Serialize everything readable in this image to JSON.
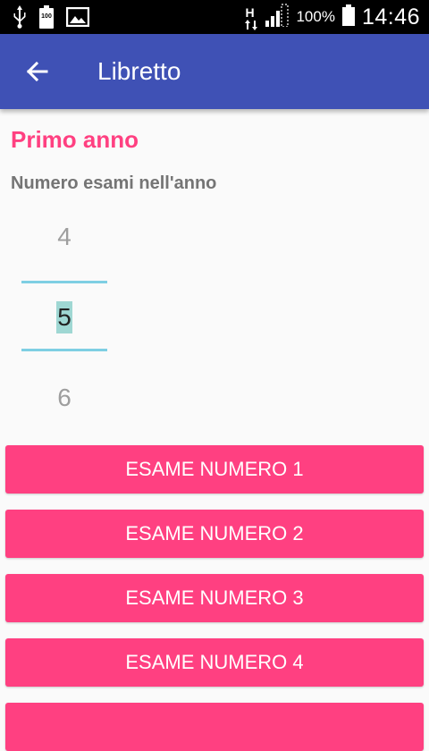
{
  "status_bar": {
    "battery_small_text": "100",
    "network_letter": "H",
    "battery_percent": "100%",
    "time": "14:46",
    "icons": [
      "usb-icon",
      "battery-saver-icon",
      "image-icon",
      "network-type-icon",
      "signal-icon",
      "battery-icon"
    ]
  },
  "app_bar": {
    "title": "Libretto",
    "back_icon": "arrow-left-icon",
    "color": "#3f51b5"
  },
  "content": {
    "section_title": "Primo anno",
    "exam_count_label": "Numero esami nell'anno",
    "picker": {
      "previous": "4",
      "current": "5",
      "next": "6"
    },
    "exam_buttons": [
      {
        "label": "ESAME NUMERO 1"
      },
      {
        "label": "ESAME NUMERO 2"
      },
      {
        "label": "ESAME NUMERO 3"
      },
      {
        "label": "ESAME NUMERO 4"
      },
      {
        "label": ""
      }
    ],
    "accent_color": "#ff4081"
  }
}
